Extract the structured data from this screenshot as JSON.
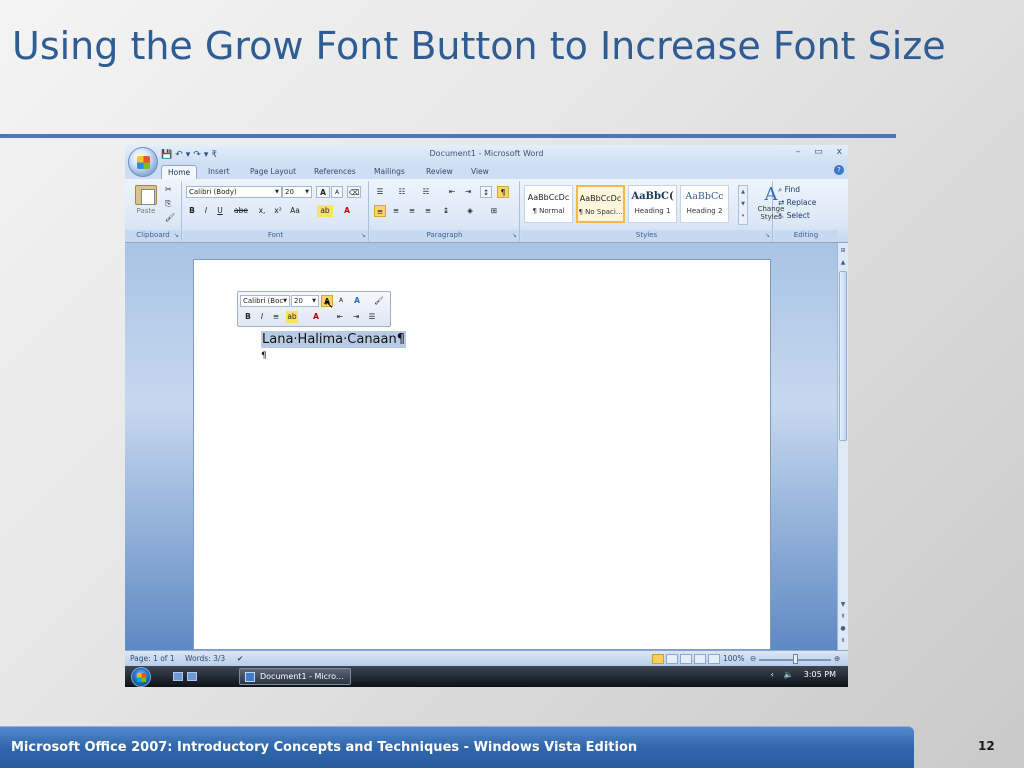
{
  "slide": {
    "title": "Using the Grow Font Button to Increase Font Size",
    "footer": "Microsoft Office 2007: Introductory Concepts and Techniques - Windows Vista Edition",
    "page_number": "12"
  },
  "word": {
    "window_title": "Document1 - Microsoft Word",
    "window_controls": [
      "–",
      "▭",
      "x"
    ],
    "qat": [
      "💾",
      "↶",
      "▾",
      "↷",
      "▾",
      "₹"
    ],
    "tabs": [
      "Home",
      "Insert",
      "Page Layout",
      "References",
      "Mailings",
      "Review",
      "View"
    ],
    "active_tab": "Home",
    "ribbon": {
      "clipboard": {
        "label": "Clipboard",
        "paste": "Paste"
      },
      "font": {
        "label": "Font",
        "font_name": "Calibri (Body)",
        "font_size": "20",
        "grow": "A",
        "shrink": "A",
        "bold": "B",
        "italic": "I",
        "underline": "U",
        "strike": "abe",
        "sub": "x,",
        "sup": "x²",
        "case": "Aa"
      },
      "paragraph": {
        "label": "Paragraph"
      },
      "styles": {
        "label": "Styles",
        "tiles": [
          {
            "sample": "AaBbCcDc",
            "name": "¶ Normal"
          },
          {
            "sample": "AaBbCcDc",
            "name": "¶ No Spaci..."
          },
          {
            "sample": "AaBbC(",
            "name": "Heading 1"
          },
          {
            "sample": "AaBbCc",
            "name": "Heading 2"
          }
        ],
        "change_styles": "Change Styles",
        "change_icon": "A"
      },
      "editing": {
        "label": "Editing",
        "find": "Find",
        "replace": "Replace",
        "select": "Select"
      }
    },
    "mini_toolbar": {
      "font_name": "Calibri (Boc",
      "font_size": "20"
    },
    "document_text": "Lana·Halima·Canaan¶",
    "paragraph_mark": "¶",
    "status": {
      "page": "Page: 1 of 1",
      "words": "Words: 3/3",
      "zoom": "100%"
    },
    "taskbar": {
      "task_button": "Document1 - Micro...",
      "clock": "3:05 PM"
    }
  }
}
